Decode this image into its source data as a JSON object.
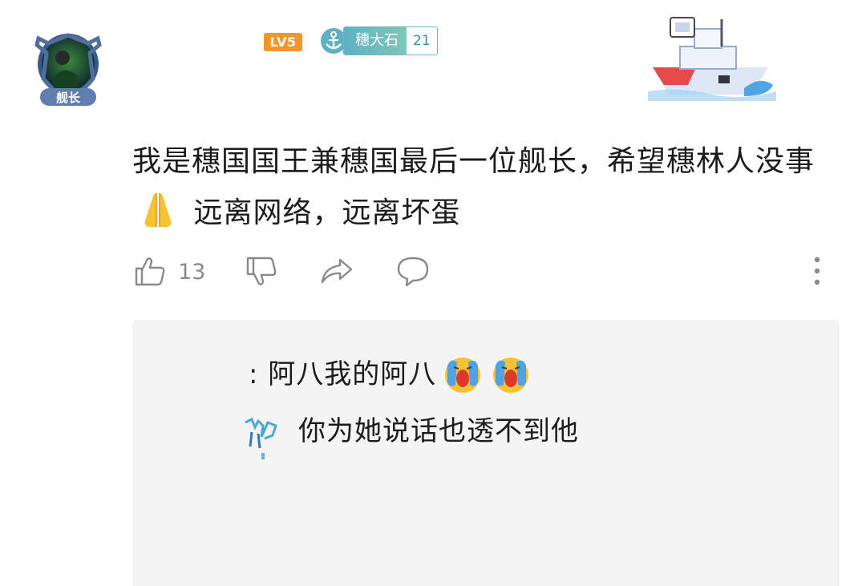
{
  "comment": {
    "user_level": "LV5",
    "medal": {
      "name": "穗大石",
      "level": "21"
    },
    "text_part1": "我是穗国国王兼穗国最后一位舰长，希望穗林人没事",
    "text_part2": "远离网络，远离坏蛋",
    "avatar_badge_text": "舰长",
    "like_count": "13"
  },
  "replies": [
    {
      "text": ": 阿八我的阿八"
    },
    {
      "text": "你为她说话也透不到他"
    }
  ],
  "colors": {
    "level_badge": "#f0962a",
    "medal_teal": "#5eb1c4",
    "reply_bg": "#f4f4f4",
    "icon_gray": "#8a8a8a"
  },
  "icons": [
    "thumb-up-icon",
    "thumb-down-icon",
    "share-icon",
    "reply-bubble-icon",
    "more-vertical-icon",
    "pray-emoji",
    "crying-emoji"
  ]
}
